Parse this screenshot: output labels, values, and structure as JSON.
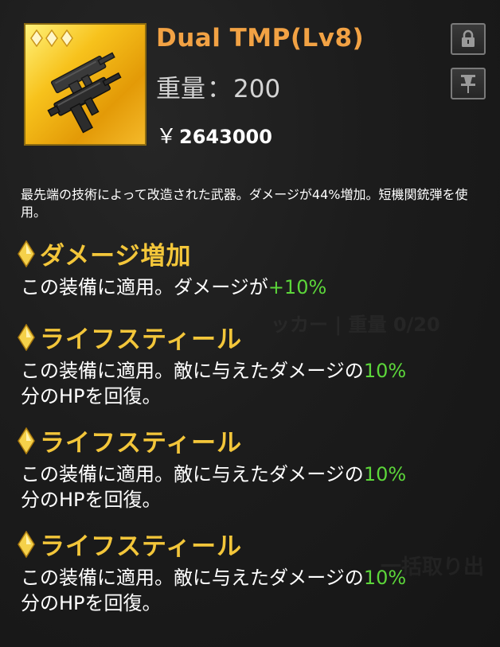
{
  "item": {
    "name": "Dual TMP(Lv8)",
    "weight_label": "重量",
    "weight_sep": "：",
    "weight_value": "200",
    "price_symbol": "￥",
    "price_value": "2643000",
    "rarity_stars": 3,
    "icon": "dual-smg-icon"
  },
  "buttons": {
    "lock_icon": "lock-icon",
    "pin_icon": "pin-icon"
  },
  "description": "最先端の技術によって改造された武器。ダメージが44%増加。短機関銃弾を使用。",
  "skills": [
    {
      "title": "ダメージ増加",
      "text": "この装備に適用。ダメージが",
      "value": "+10%",
      "suffix": ""
    },
    {
      "title": "ライフスティール",
      "text": "この装備に適用。敵に与えたダメージの",
      "value": "10%",
      "suffix": "分のHPを回復。"
    },
    {
      "title": "ライフスティール",
      "text": "この装備に適用。敵に与えたダメージの",
      "value": "10%",
      "suffix": "分のHPを回復。"
    },
    {
      "title": "ライフスティール",
      "text": "この装備に適用。敵に与えたダメージの",
      "value": "10%",
      "suffix": "分のHPを回復。"
    }
  ],
  "background_text": {
    "row1": "ッカー | 重量 0/20",
    "row2": "一括取り出"
  },
  "colors": {
    "name": "#f2a244",
    "skill_title": "#f3c63a",
    "value_green": "#5cd63a",
    "rarity_gold": "#f5d14a"
  }
}
